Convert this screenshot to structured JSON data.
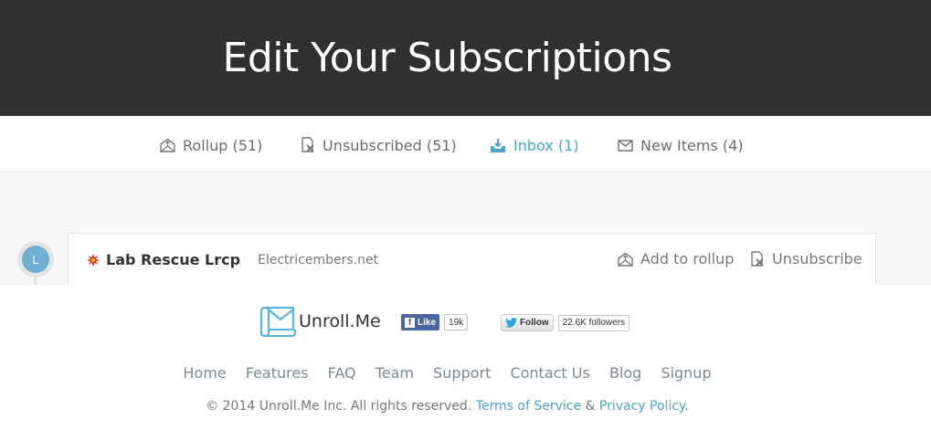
{
  "header": {
    "title": "Edit Your Subscriptions"
  },
  "tabs": [
    {
      "label": "Rollup (51)",
      "icon": "rollup-icon"
    },
    {
      "label": "Unsubscribed (51)",
      "icon": "unsubscribe-icon"
    },
    {
      "label": "Inbox (1)",
      "icon": "inbox-icon",
      "active": true
    },
    {
      "label": "New Items (4)",
      "icon": "envelope-icon"
    }
  ],
  "subscription": {
    "avatar_letter": "L",
    "name": "Lab Rescue Lrcp",
    "domain": "Electricembers.net",
    "add_to_rollup": "Add to rollup",
    "unsubscribe": "Unsubscribe"
  },
  "footer": {
    "logo_text": "Unroll.Me",
    "fb_like_label": "Like",
    "fb_like_count": "19k",
    "twitter_follow_label": "Follow",
    "twitter_followers": "22.6K followers",
    "links": [
      "Home",
      "Features",
      "FAQ",
      "Team",
      "Support",
      "Contact Us",
      "Blog",
      "Signup"
    ],
    "copyright_prefix": "© 2014 Unroll.Me Inc. All rights reserved.",
    "terms_label": "Terms of Service",
    "ampersand": "&",
    "privacy_label": "Privacy Policy",
    "period": "."
  },
  "colors": {
    "header_bg": "#303030",
    "accent": "#4aa4d0",
    "facebook": "#4a66a0"
  }
}
